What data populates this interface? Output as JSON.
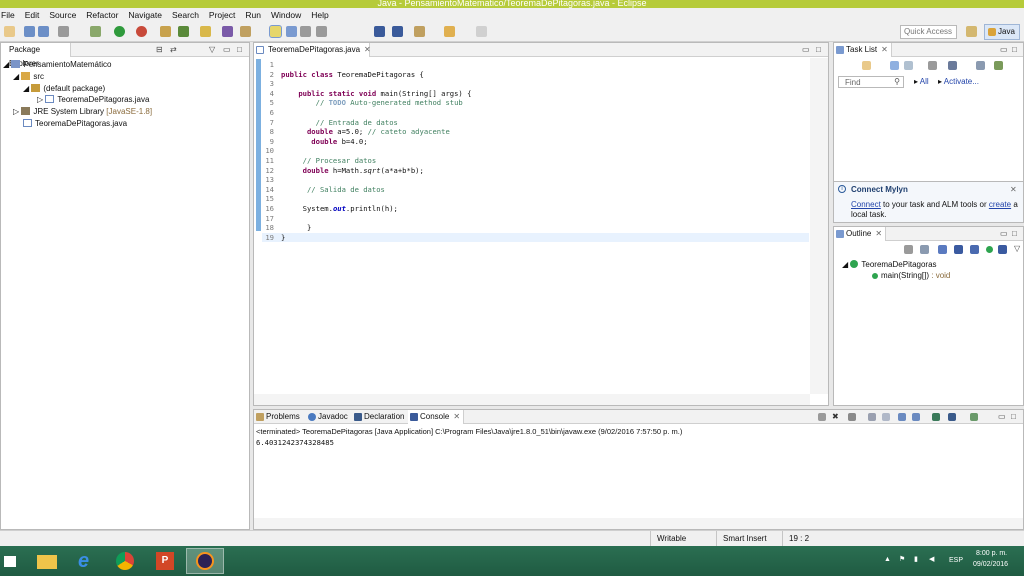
{
  "window": {
    "title": "Java - PensamientoMatematico/TeoremaDePitagoras.java - Eclipse"
  },
  "menu": [
    "File",
    "Edit",
    "Source",
    "Refactor",
    "Navigate",
    "Search",
    "Project",
    "Run",
    "Window",
    "Help"
  ],
  "toolbar": {
    "quick_access": "Quick Access",
    "perspective": "Java"
  },
  "package_explorer": {
    "tab": "Package Explorer",
    "tree": [
      {
        "label": "PensamientoMatemático",
        "icon": "project-icon"
      },
      {
        "label": "src",
        "icon": "source-folder-icon"
      },
      {
        "label": "(default package)",
        "icon": "package-icon"
      },
      {
        "label": "TeoremaDePitagoras.java",
        "icon": "java-file-icon"
      },
      {
        "label": "JRE System Library",
        "suffix": "[JavaSE-1.8]",
        "icon": "library-icon"
      },
      {
        "label": "TeoremaDePitagoras.java",
        "icon": "java-file-icon"
      }
    ]
  },
  "editor": {
    "tab": "TeoremaDePitagoras.java",
    "line_numbers": [
      "1",
      "2",
      "3",
      "4",
      "5",
      "6",
      "7",
      "8",
      "9",
      "10",
      "11",
      "12",
      "13",
      "14",
      "15",
      "16",
      "17",
      "18",
      "19"
    ]
  },
  "task_list": {
    "tab": "Task List",
    "find_placeholder": "Find",
    "all": "All",
    "activate": "Activate..."
  },
  "mylyn": {
    "title": "Connect Mylyn",
    "connect": "Connect",
    "text1": " to your task and ALM tools or ",
    "create": "create",
    "text2": " a local task."
  },
  "outline": {
    "tab": "Outline",
    "class_name": "TeoremaDePitagoras",
    "method": "main(String[])",
    "method_type": ": void"
  },
  "bottom_tabs": [
    "Problems",
    "Javadoc",
    "Declaration",
    "Console"
  ],
  "console": {
    "header": "<terminated> TeoremaDePitagoras [Java Application] C:\\Program Files\\Java\\jre1.8.0_51\\bin\\javaw.exe (9/02/2016 7:57:50 p. m.)",
    "output": "6.4031242374328485"
  },
  "status": {
    "mode": "Writable",
    "insert": "Smart Insert",
    "position": "19 : 2"
  },
  "taskbar": {
    "lang": "ESP",
    "time": "8:00 p. m.",
    "date": "09/02/2016"
  },
  "colors": {
    "title_bar": "#b6cb3a",
    "taskbar": "#245f46",
    "keyword": "#7f0055",
    "comment": "#3f7f5f"
  }
}
